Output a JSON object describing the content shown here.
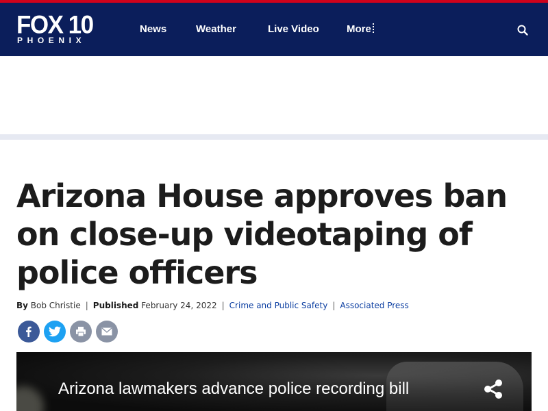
{
  "brand": {
    "logo_main": "FOX 10",
    "logo_sub": "PHOENIX",
    "header_bg": "#0b1e5b",
    "accent_red": "#d0021b"
  },
  "nav": {
    "items": [
      {
        "label": "News"
      },
      {
        "label": "Weather"
      },
      {
        "label": "Live Video"
      },
      {
        "label": "More"
      }
    ],
    "search_icon": "search-icon"
  },
  "article": {
    "headline": "Arizona House approves ban on close-up videotaping of police officers",
    "byline_prefix": "By",
    "author": "Bob Christie",
    "published_label": "Published",
    "published_date": "February 24, 2022",
    "category": "Crime and Public Safety",
    "source": "Associated Press"
  },
  "share": {
    "buttons": [
      "facebook-icon",
      "twitter-icon",
      "print-icon",
      "email-icon"
    ]
  },
  "video": {
    "title": "Arizona lawmakers advance police recording bill",
    "share_icon": "share-icon"
  }
}
